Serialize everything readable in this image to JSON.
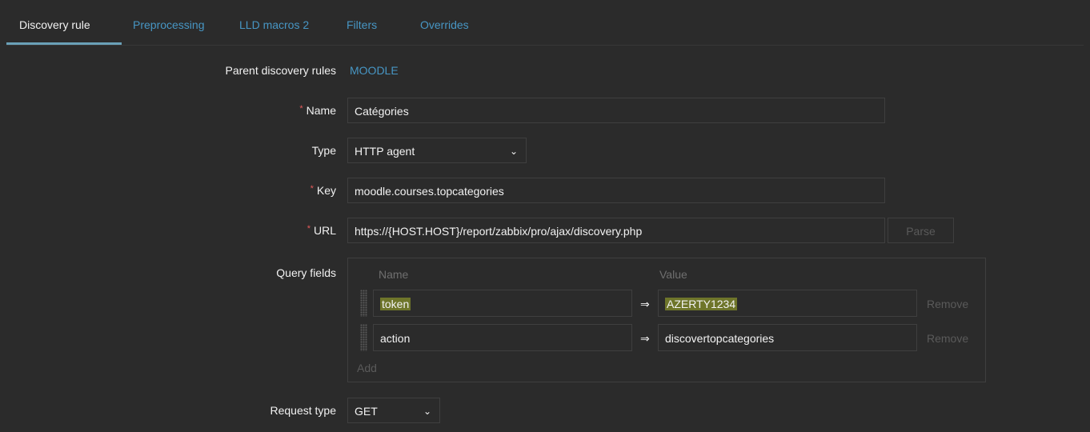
{
  "tabs": [
    {
      "label": "Discovery rule"
    },
    {
      "label": "Preprocessing"
    },
    {
      "label": "LLD macros 2"
    },
    {
      "label": "Filters"
    },
    {
      "label": "Overrides"
    }
  ],
  "form": {
    "parent_label": "Parent discovery rules",
    "parent_value": "MOODLE",
    "name_label": "Name",
    "name_value": "Catégories",
    "type_label": "Type",
    "type_value": "HTTP agent",
    "key_label": "Key",
    "key_value": "moodle.courses.topcategories",
    "url_label": "URL",
    "url_value": "https://{HOST.HOST}/report/zabbix/pro/ajax/discovery.php",
    "parse_label": "Parse",
    "required_mark": "*",
    "query_label": "Query fields",
    "query_name_header": "Name",
    "query_value_header": "Value",
    "query_rows": [
      {
        "name": "token",
        "arrow": "⇒",
        "value": "AZERTY1234",
        "remove": "Remove"
      },
      {
        "name": "action",
        "arrow": "⇒",
        "value": "discovertopcategories",
        "remove": "Remove"
      }
    ],
    "add_label": "Add",
    "request_type_label": "Request type",
    "request_type_value": "GET"
  },
  "colors": {
    "background": "#2b2b2b",
    "link": "#4796c4",
    "required": "#e45959",
    "highlight": "#ebff28"
  }
}
